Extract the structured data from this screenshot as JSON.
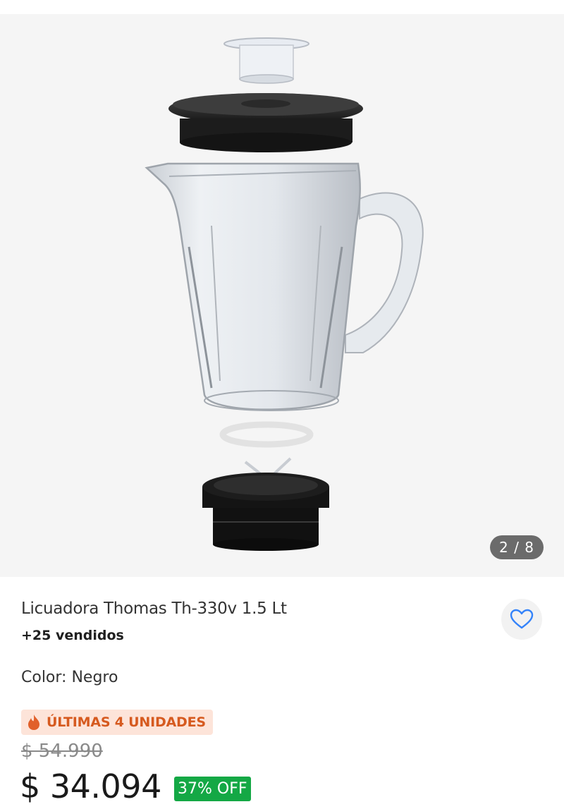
{
  "product": {
    "image_counter": "2 / 8",
    "title": "Licuadora Thomas Th-330v 1.5 Lt",
    "sold": "+25 vendidos",
    "color_label": "Color:",
    "color_value": "Negro",
    "stock_badge": "ÚLTIMAS 4 UNIDADES",
    "old_price": "$ 54.990",
    "price": "$ 34.094",
    "discount": "37% OFF"
  },
  "icons": {
    "favorite": "heart-outline-icon",
    "stock": "flame-icon"
  },
  "colors": {
    "accent_blue": "#3483fa",
    "badge_bg": "#fde4d9",
    "badge_text": "#d65a1f",
    "discount_bg": "#14a845"
  }
}
